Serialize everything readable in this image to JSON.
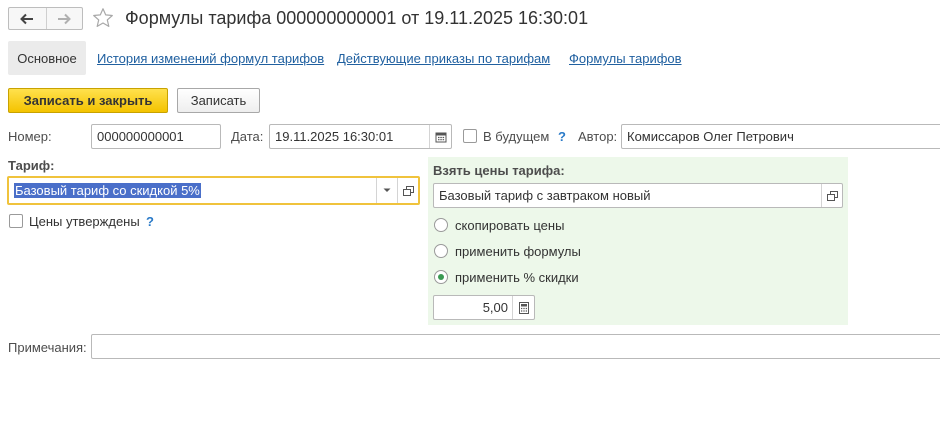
{
  "window": {
    "title": "Формулы тарифа 000000000001 от 19.11.2025 16:30:01"
  },
  "tabs": [
    {
      "label": "Основное",
      "active": true
    },
    {
      "label": "История изменений формул тарифов"
    },
    {
      "label": "Действующие приказы по тарифам"
    },
    {
      "label": "Формулы тарифов"
    }
  ],
  "toolbar": {
    "save_close_label": "Записать и закрыть",
    "save_label": "Записать"
  },
  "form": {
    "number_label": "Номер:",
    "number_value": "000000000001",
    "date_label": "Дата:",
    "date_value": "19.11.2025 16:30:01",
    "future_label": "В будущем",
    "future_checked": false,
    "help_mark": "?",
    "author_label": "Автор:",
    "author_value": "Комиссаров Олег Петрович",
    "tariff_label": "Тариф:",
    "tariff_value": "Базовый тариф со скидкой 5%",
    "prices_approved_label": "Цены утверждены",
    "prices_approved_checked": false,
    "notes_label": "Примечания:",
    "notes_value": ""
  },
  "price_source": {
    "title": "Взять цены тарифа:",
    "tariff_value": "Базовый тариф с завтраком новый",
    "options": [
      {
        "label": "скопировать цены",
        "selected": false
      },
      {
        "label": "применить формулы",
        "selected": false
      },
      {
        "label": "применить % скидки",
        "selected": true
      }
    ],
    "discount_value": "5,00"
  },
  "colors": {
    "accent_yellow": "#f4c300",
    "link_blue": "#2060a0",
    "panel_green": "#edf8ea",
    "radio_green": "#3b9a53",
    "selection_blue": "#4a6fc9",
    "focus_border": "#f0c33c"
  },
  "icons": {
    "back": "arrow-left-icon",
    "forward": "arrow-right-icon",
    "favorite": "star-icon",
    "calendar": "calendar-icon",
    "dropdown": "chevron-down-icon",
    "open": "open-form-icon",
    "calculator": "calculator-icon"
  }
}
